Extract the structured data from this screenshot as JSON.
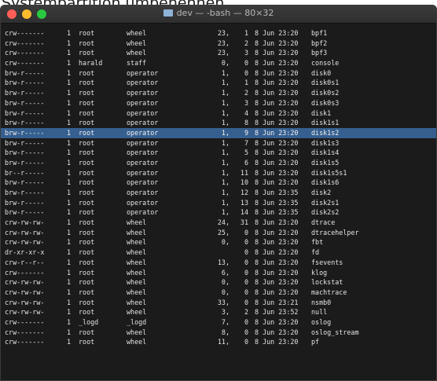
{
  "caption": "Systempartition umbenennen",
  "window": {
    "title": "dev — -bash — 80×32",
    "title_icon": "folder-icon"
  },
  "listing": [
    {
      "perm": "crw-------",
      "links": "1",
      "owner": "root",
      "group": "wheel",
      "major": "23,",
      "minor": "1",
      "date": "8 Jun 23:20",
      "name": "bpf1"
    },
    {
      "perm": "crw-------",
      "links": "1",
      "owner": "root",
      "group": "wheel",
      "major": "23,",
      "minor": "2",
      "date": "8 Jun 23:20",
      "name": "bpf2"
    },
    {
      "perm": "crw-------",
      "links": "1",
      "owner": "root",
      "group": "wheel",
      "major": "23,",
      "minor": "3",
      "date": "8 Jun 23:20",
      "name": "bpf3"
    },
    {
      "perm": "crw-------",
      "links": "1",
      "owner": "harald",
      "group": "staff",
      "major": "0,",
      "minor": "0",
      "date": "8 Jun 23:20",
      "name": "console"
    },
    {
      "perm": "brw-r-----",
      "links": "1",
      "owner": "root",
      "group": "operator",
      "major": "1,",
      "minor": "0",
      "date": "8 Jun 23:20",
      "name": "disk0"
    },
    {
      "perm": "brw-r-----",
      "links": "1",
      "owner": "root",
      "group": "operator",
      "major": "1,",
      "minor": "1",
      "date": "8 Jun 23:20",
      "name": "disk0s1"
    },
    {
      "perm": "brw-r-----",
      "links": "1",
      "owner": "root",
      "group": "operator",
      "major": "1,",
      "minor": "2",
      "date": "8 Jun 23:20",
      "name": "disk0s2"
    },
    {
      "perm": "brw-r-----",
      "links": "1",
      "owner": "root",
      "group": "operator",
      "major": "1,",
      "minor": "3",
      "date": "8 Jun 23:20",
      "name": "disk0s3"
    },
    {
      "perm": "brw-r-----",
      "links": "1",
      "owner": "root",
      "group": "operator",
      "major": "1,",
      "minor": "4",
      "date": "8 Jun 23:20",
      "name": "disk1"
    },
    {
      "perm": "brw-r-----",
      "links": "1",
      "owner": "root",
      "group": "operator",
      "major": "1,",
      "minor": "8",
      "date": "8 Jun 23:20",
      "name": "disk1s1"
    },
    {
      "perm": "brw-r-----",
      "links": "1",
      "owner": "root",
      "group": "operator",
      "major": "1,",
      "minor": "9",
      "date": "8 Jun 23:20",
      "name": "disk1s2",
      "selected": true
    },
    {
      "perm": "brw-r-----",
      "links": "1",
      "owner": "root",
      "group": "operator",
      "major": "1,",
      "minor": "7",
      "date": "8 Jun 23:20",
      "name": "disk1s3"
    },
    {
      "perm": "brw-r-----",
      "links": "1",
      "owner": "root",
      "group": "operator",
      "major": "1,",
      "minor": "5",
      "date": "8 Jun 23:20",
      "name": "disk1s4"
    },
    {
      "perm": "brw-r-----",
      "links": "1",
      "owner": "root",
      "group": "operator",
      "major": "1,",
      "minor": "6",
      "date": "8 Jun 23:20",
      "name": "disk1s5"
    },
    {
      "perm": "br--r-----",
      "links": "1",
      "owner": "root",
      "group": "operator",
      "major": "1,",
      "minor": "11",
      "date": "8 Jun 23:20",
      "name": "disk1s5s1"
    },
    {
      "perm": "brw-r-----",
      "links": "1",
      "owner": "root",
      "group": "operator",
      "major": "1,",
      "minor": "10",
      "date": "8 Jun 23:20",
      "name": "disk1s6"
    },
    {
      "perm": "brw-r-----",
      "links": "1",
      "owner": "root",
      "group": "operator",
      "major": "1,",
      "minor": "12",
      "date": "8 Jun 23:35",
      "name": "disk2"
    },
    {
      "perm": "brw-r-----",
      "links": "1",
      "owner": "root",
      "group": "operator",
      "major": "1,",
      "minor": "13",
      "date": "8 Jun 23:35",
      "name": "disk2s1"
    },
    {
      "perm": "brw-r-----",
      "links": "1",
      "owner": "root",
      "group": "operator",
      "major": "1,",
      "minor": "14",
      "date": "8 Jun 23:35",
      "name": "disk2s2"
    },
    {
      "perm": "crw-rw-rw-",
      "links": "1",
      "owner": "root",
      "group": "wheel",
      "major": "24,",
      "minor": "31",
      "date": "8 Jun 23:20",
      "name": "dtrace"
    },
    {
      "perm": "crw-rw-rw-",
      "links": "1",
      "owner": "root",
      "group": "wheel",
      "major": "25,",
      "minor": "0",
      "date": "8 Jun 23:20",
      "name": "dtracehelper"
    },
    {
      "perm": "crw-rw-rw-",
      "links": "1",
      "owner": "root",
      "group": "wheel",
      "major": "0,",
      "minor": "0",
      "date": "8 Jun 23:20",
      "name": "fbt"
    },
    {
      "perm": "dr-xr-xr-x",
      "links": "1",
      "owner": "root",
      "group": "wheel",
      "major": "",
      "minor": "0",
      "date": "8 Jun 23:20",
      "name": "fd"
    },
    {
      "perm": "crw-r--r--",
      "links": "1",
      "owner": "root",
      "group": "wheel",
      "major": "13,",
      "minor": "0",
      "date": "8 Jun 23:20",
      "name": "fsevents"
    },
    {
      "perm": "crw-------",
      "links": "1",
      "owner": "root",
      "group": "wheel",
      "major": "6,",
      "minor": "0",
      "date": "8 Jun 23:20",
      "name": "klog"
    },
    {
      "perm": "crw-rw-rw-",
      "links": "1",
      "owner": "root",
      "group": "wheel",
      "major": "0,",
      "minor": "0",
      "date": "8 Jun 23:20",
      "name": "lockstat"
    },
    {
      "perm": "crw-rw-rw-",
      "links": "1",
      "owner": "root",
      "group": "wheel",
      "major": "0,",
      "minor": "0",
      "date": "8 Jun 23:20",
      "name": "machtrace"
    },
    {
      "perm": "crw-rw-rw-",
      "links": "1",
      "owner": "root",
      "group": "wheel",
      "major": "33,",
      "minor": "0",
      "date": "8 Jun 23:21",
      "name": "nsmb0"
    },
    {
      "perm": "crw-rw-rw-",
      "links": "1",
      "owner": "root",
      "group": "wheel",
      "major": "3,",
      "minor": "2",
      "date": "8 Jun 23:52",
      "name": "null"
    },
    {
      "perm": "crw-------",
      "links": "1",
      "owner": "_logd",
      "group": "_logd",
      "major": "7,",
      "minor": "0",
      "date": "8 Jun 23:20",
      "name": "oslog"
    },
    {
      "perm": "crw-------",
      "links": "1",
      "owner": "root",
      "group": "wheel",
      "major": "8,",
      "minor": "0",
      "date": "8 Jun 23:20",
      "name": "oslog_stream"
    },
    {
      "perm": "crw-------",
      "links": "1",
      "owner": "root",
      "group": "wheel",
      "major": "11,",
      "minor": "0",
      "date": "8 Jun 23:20",
      "name": "pf"
    }
  ]
}
